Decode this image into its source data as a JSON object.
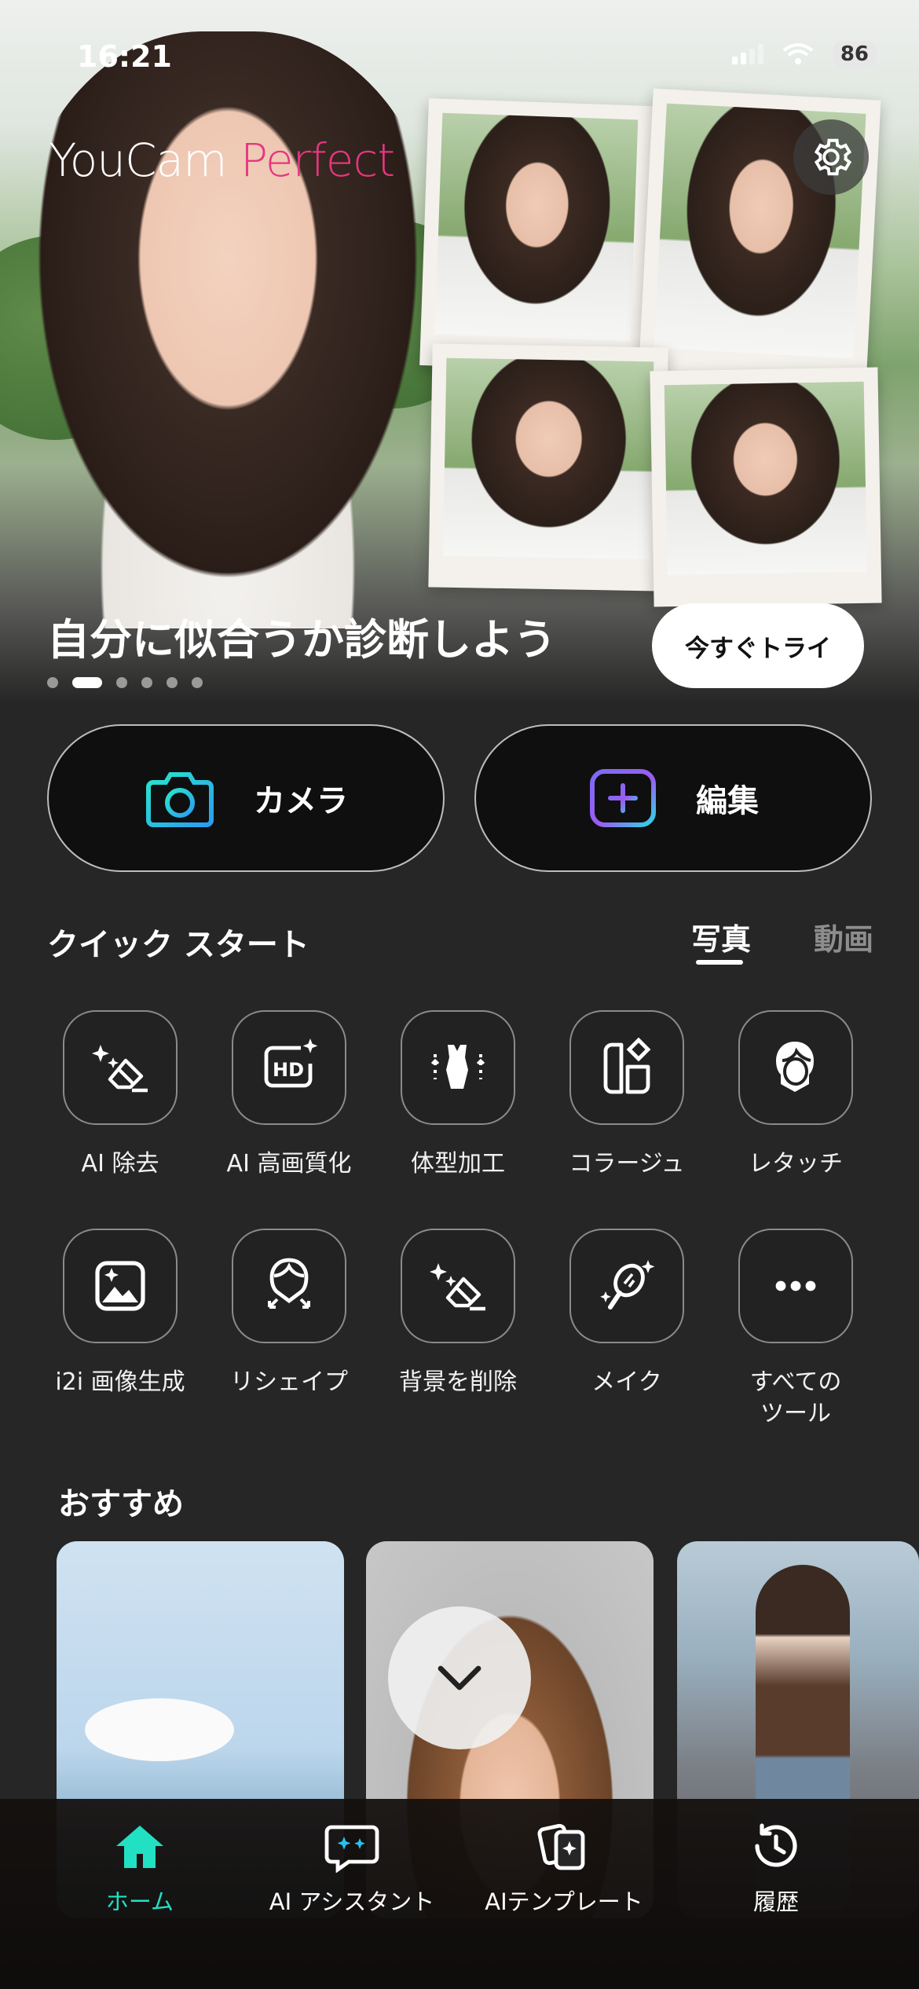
{
  "status_bar": {
    "time": "16:21",
    "battery": "86"
  },
  "hero": {
    "logo_part1": "YouCam",
    "logo_part2": "Perfect",
    "title": "自分に似合うか診断しよう",
    "try_button": "今すぐトライ",
    "carousel_total": 6,
    "carousel_active": 2
  },
  "actions": {
    "camera": "カメラ",
    "edit": "編集"
  },
  "quick_start": {
    "title": "クイック スタート",
    "tabs": [
      "写真",
      "動画"
    ],
    "tools": [
      {
        "label": "AI 除去",
        "icon": "ai-eraser-icon"
      },
      {
        "label": "AI 高画質化",
        "icon": "hd-enhance-icon"
      },
      {
        "label": "体型加工",
        "icon": "body-shape-icon"
      },
      {
        "label": "コラージュ",
        "icon": "collage-icon"
      },
      {
        "label": "レタッチ",
        "icon": "retouch-face-icon"
      },
      {
        "label": "i2i 画像生成",
        "icon": "image-generate-icon"
      },
      {
        "label": "リシェイプ",
        "icon": "reshape-icon"
      },
      {
        "label": "背景を削除",
        "icon": "remove-background-icon"
      },
      {
        "label": "メイク",
        "icon": "makeup-mirror-icon"
      },
      {
        "label": "すべての\nツール",
        "icon": "more-dots-icon"
      }
    ]
  },
  "recommended": {
    "title": "おすすめ"
  },
  "bottom_nav": [
    {
      "label": "ホーム",
      "icon": "home-icon",
      "active": true
    },
    {
      "label": "AI アシスタント",
      "icon": "ai-assistant-icon",
      "active": false
    },
    {
      "label": "AIテンプレート",
      "icon": "ai-template-icon",
      "active": false
    },
    {
      "label": "履歴",
      "icon": "history-icon",
      "active": false
    }
  ],
  "colors": {
    "accent_teal": "#21e0c3",
    "brand_pink": "#e6367f",
    "background": "#262626"
  }
}
